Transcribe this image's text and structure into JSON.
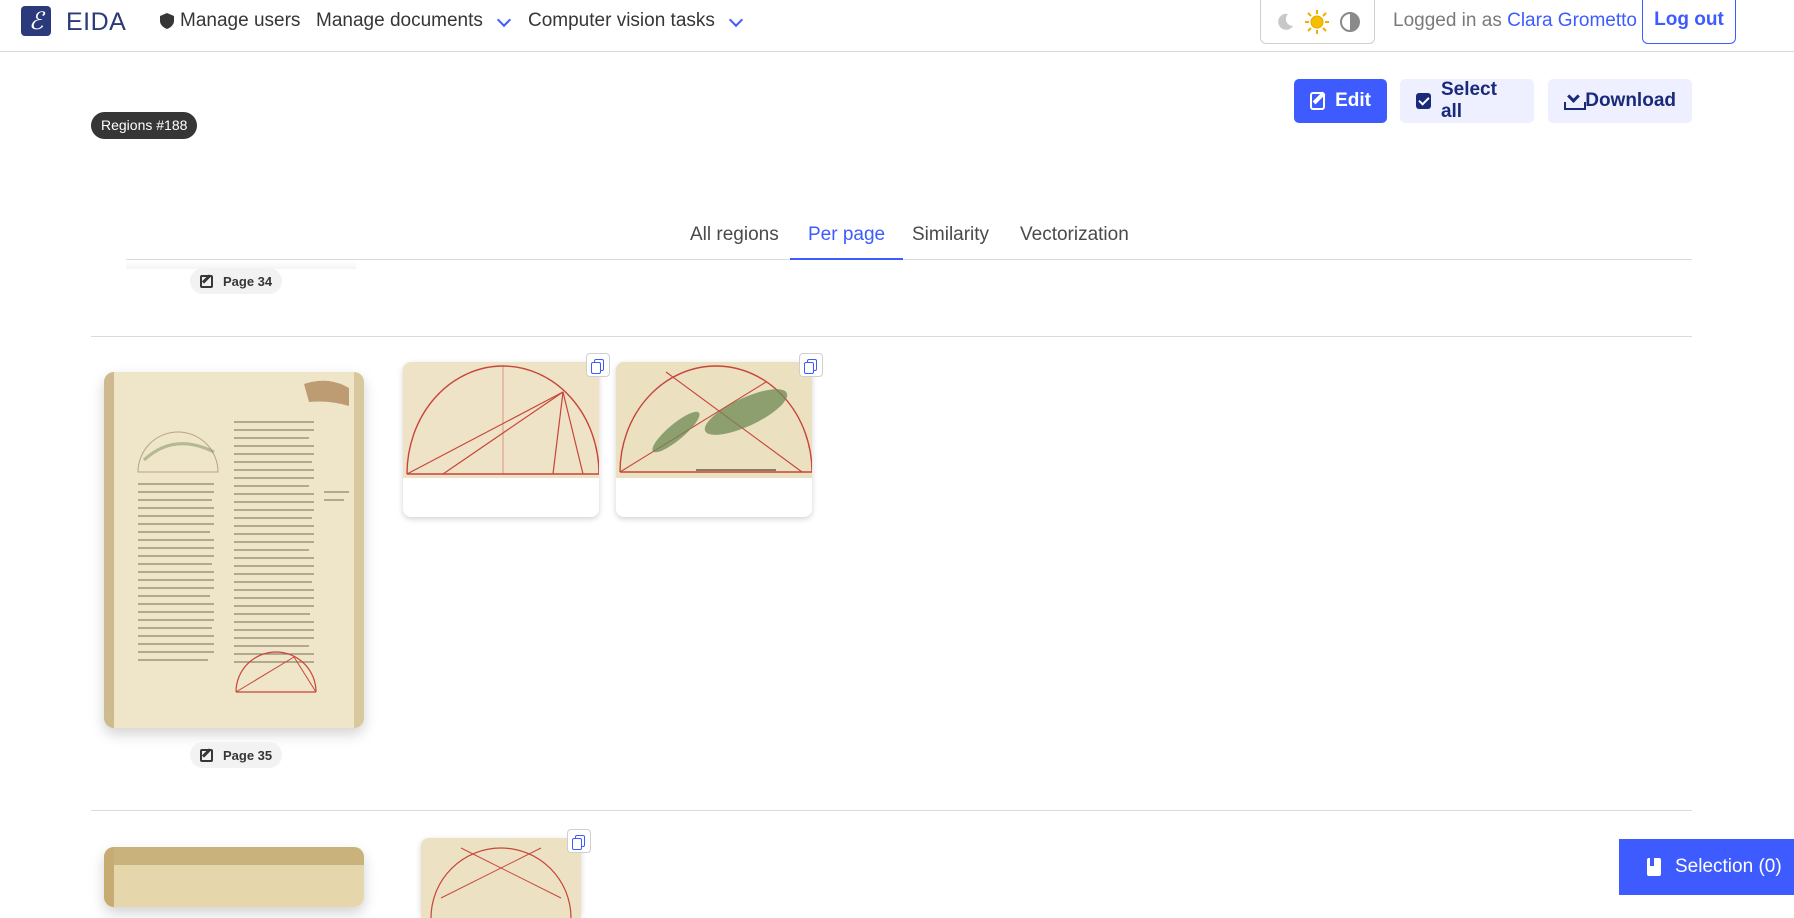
{
  "header": {
    "logo_letter": "ℰ",
    "brand": "EIDA",
    "nav": [
      {
        "label": "Manage users",
        "icon": "shield-icon"
      },
      {
        "label": "Manage documents",
        "icon": "chevron-down-icon"
      },
      {
        "label": "Computer vision tasks",
        "icon": "chevron-down-icon"
      }
    ],
    "theme_icons": [
      "moon-icon",
      "sun-icon",
      "contrast-icon"
    ],
    "logged_prefix": "Logged in as",
    "user": "Clara Grometto",
    "logout": "Log out"
  },
  "toolbar": {
    "badge": "Regions #188",
    "edit": "Edit",
    "select_all": "Select all",
    "download": "Download"
  },
  "tabs": [
    {
      "label": "All regions",
      "active": false
    },
    {
      "label": "Per page",
      "active": true
    },
    {
      "label": "Similarity",
      "active": false
    },
    {
      "label": "Vectorization",
      "active": false
    }
  ],
  "pages": [
    {
      "label": "Page 34"
    },
    {
      "label": "Page 35",
      "regions": 2
    },
    {
      "label": "",
      "regions": 1
    }
  ],
  "selection": "Selection (0)",
  "colors": {
    "accent": "#3e5bff",
    "brand": "#2b3a7a",
    "parchment": "#e9dfc1",
    "diagram_red": "#c8453a"
  }
}
